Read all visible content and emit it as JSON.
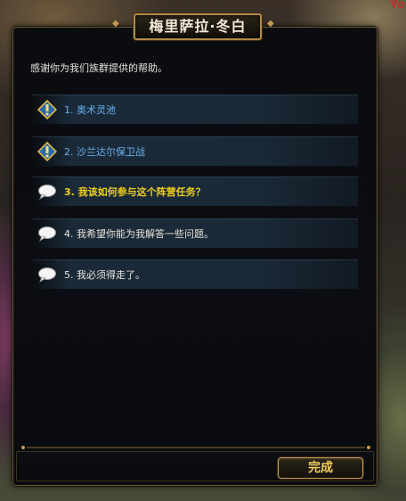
{
  "background_corner_text": "Yo",
  "dialog": {
    "title": "梅里萨拉·冬白",
    "intro": "感谢你为我们族群提供的帮助。",
    "options": [
      {
        "label": "1. 奥术灵池",
        "icon": "quest-exclamation-icon",
        "style": "quest"
      },
      {
        "label": "2. 沙兰达尔保卫战",
        "icon": "quest-exclamation-icon",
        "style": "quest"
      },
      {
        "label": "3. 我该如何参与这个阵营任务？",
        "icon": "speech-bubble-icon",
        "style": "highlight"
      },
      {
        "label": "4. 我希望你能为我解答一些问题。",
        "icon": "speech-bubble-icon",
        "style": "plain"
      },
      {
        "label": "5. 我必须得走了。",
        "icon": "speech-bubble-icon",
        "style": "plain"
      }
    ],
    "complete_button": "完成"
  },
  "colors": {
    "frame_gold": "#b08a48",
    "quest_text": "#6ab0f0",
    "highlight_text": "#f0d020",
    "plain_text": "#e8e4dc",
    "button_text": "#f2d060"
  }
}
